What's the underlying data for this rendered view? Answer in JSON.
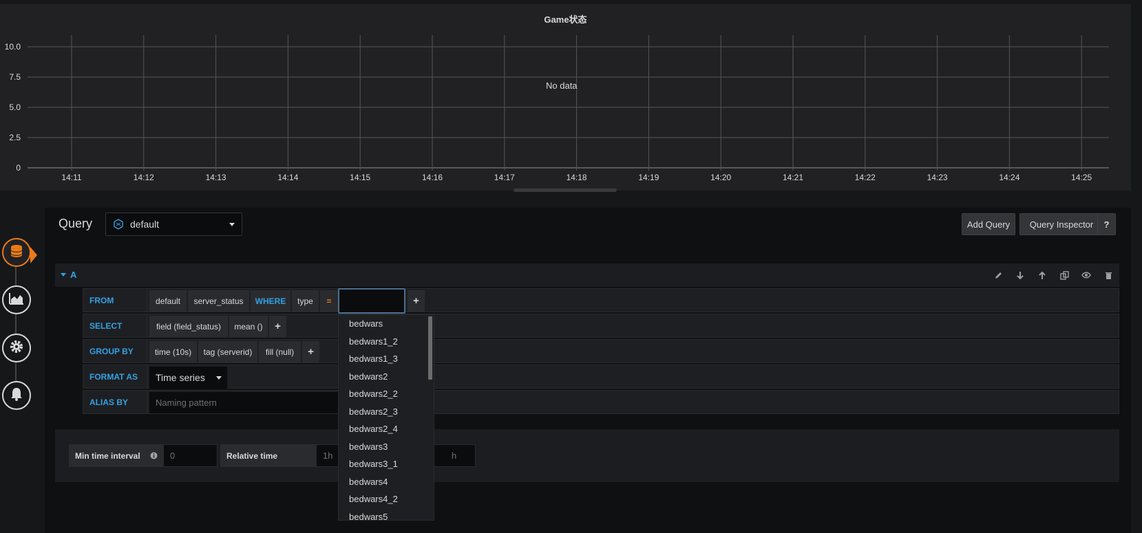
{
  "panel": {
    "title": "Game状态",
    "no_data": "No data"
  },
  "chart_data": {
    "type": "line",
    "title": "Game状态",
    "x_ticks": [
      "14:11",
      "14:12",
      "14:13",
      "14:14",
      "14:15",
      "14:16",
      "14:17",
      "14:18",
      "14:19",
      "14:20",
      "14:21",
      "14:22",
      "14:23",
      "14:24",
      "14:25"
    ],
    "y_ticks": [
      "0",
      "2.5",
      "5.0",
      "7.5",
      "10.0"
    ],
    "ylim": [
      0,
      10
    ],
    "series": [],
    "grid": true,
    "annotation": "No data"
  },
  "query": {
    "title": "Query",
    "datasource": "default",
    "add_query": "Add Query",
    "query_inspector": "Query Inspector",
    "help": "?"
  },
  "row_a": {
    "label": "A"
  },
  "rows": {
    "from": {
      "keyword": "FROM",
      "db": "default",
      "measurement": "server_status",
      "where_keyword": "WHERE",
      "tag": "type",
      "operator": "=",
      "plus": "+"
    },
    "select": {
      "keyword": "SELECT",
      "field": "field (field_status)",
      "fn": "mean ()",
      "plus": "+"
    },
    "group_by": {
      "keyword": "GROUP BY",
      "time": "time (10s)",
      "tag": "tag (serverid)",
      "fill": "fill (null)",
      "plus": "+"
    },
    "format_as": {
      "keyword": "FORMAT AS",
      "value": "Time series"
    },
    "alias_by": {
      "keyword": "ALIAS BY",
      "placeholder": "Naming pattern"
    }
  },
  "options": {
    "min_time_label": "Min time interval",
    "min_time_placeholder": "0",
    "relative_time_label": "Relative time",
    "relative_time_placeholder": "1h",
    "time_shift_placeholder": "h"
  },
  "dropdown": {
    "items": [
      "bedwars",
      "bedwars1_2",
      "bedwars1_3",
      "bedwars2",
      "bedwars2_2",
      "bedwars2_3",
      "bedwars2_4",
      "bedwars3",
      "bedwars3_1",
      "bedwars4",
      "bedwars4_2",
      "bedwars5"
    ]
  },
  "colors": {
    "accent_blue": "#33a2e5",
    "accent_orange": "#eb7b18",
    "panel_bg": "#212124"
  }
}
